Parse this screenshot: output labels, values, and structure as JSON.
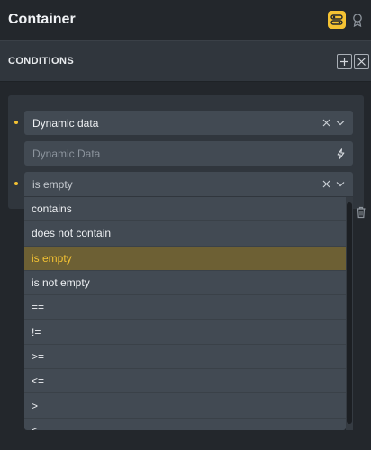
{
  "header": {
    "title": "Container",
    "icons": [
      "toggle-icon",
      "award-icon"
    ]
  },
  "conditions": {
    "section_title": "CONDITIONS",
    "field1_value": "Dynamic data",
    "field2_placeholder": "Dynamic Data",
    "field3_value": "is empty",
    "operators": [
      "contains",
      "does not contain",
      "is empty",
      "is not empty",
      "==",
      "!=",
      ">=",
      "<=",
      ">",
      "<"
    ],
    "selected_operator": "is empty"
  },
  "colors": {
    "accent": "#f4c233",
    "panel": "#30363d",
    "field": "#424a53",
    "selected_row": "#6d6034"
  }
}
